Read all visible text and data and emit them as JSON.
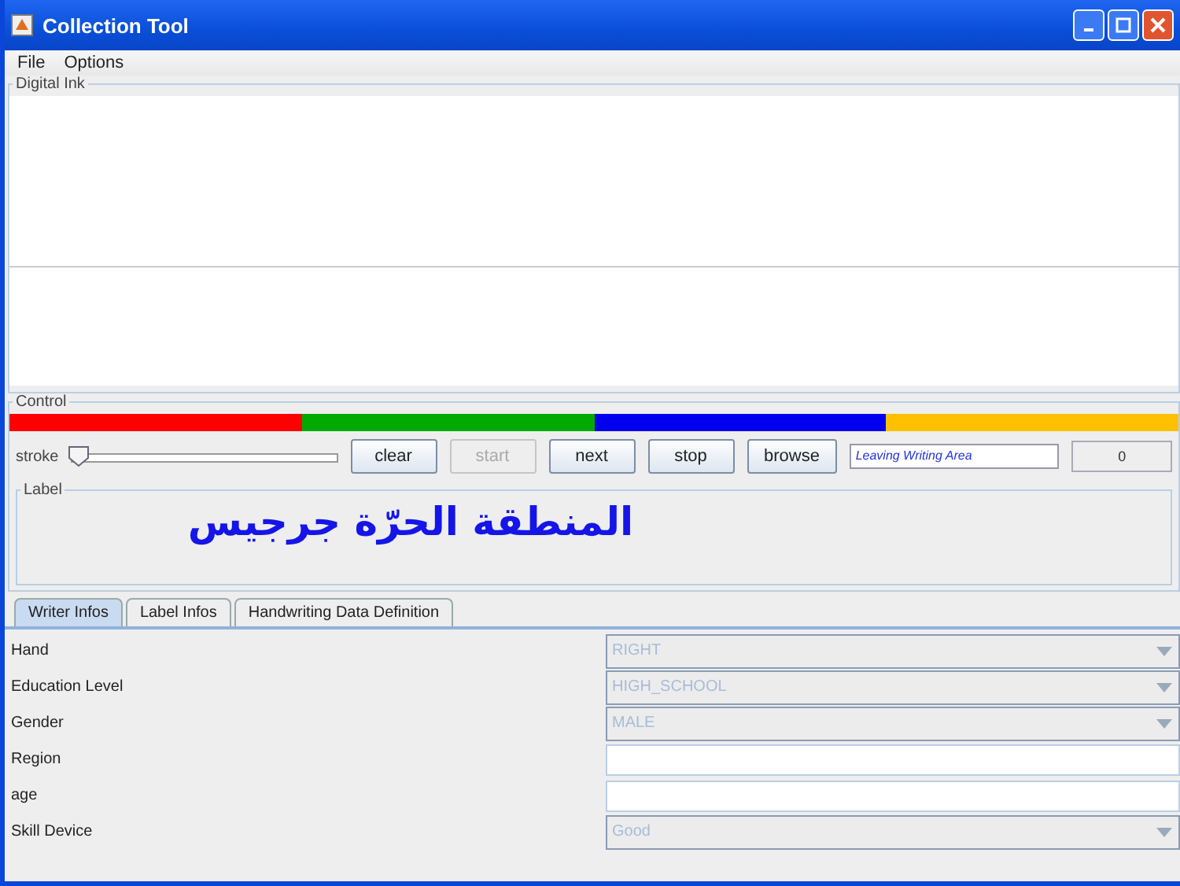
{
  "window": {
    "title": "Collection Tool"
  },
  "menu": [
    "File",
    "Options"
  ],
  "digital_ink": {
    "title": "Digital Ink"
  },
  "control": {
    "title": "Control",
    "color_bar": [
      {
        "color": "#ff0000"
      },
      {
        "color": "#00aa00"
      },
      {
        "color": "#0000ee"
      },
      {
        "color": "#ffc000"
      }
    ],
    "stroke": {
      "label": "stroke",
      "level": 0.0
    },
    "buttons": [
      {
        "label": "clear",
        "disabled": false
      },
      {
        "label": "start",
        "disabled": true
      },
      {
        "label": "next",
        "disabled": false
      },
      {
        "label": "stop",
        "disabled": false
      },
      {
        "label": "browse",
        "disabled": false
      }
    ],
    "status_field": "Leaving Writing Area",
    "count": "0"
  },
  "label": {
    "title": "Label",
    "text": "المنطقة الحرّة جرجيس"
  },
  "tabs": [
    {
      "label": "Writer Infos",
      "selected": true
    },
    {
      "label": "Label Infos",
      "selected": false
    },
    {
      "label": "Handwriting Data Definition",
      "selected": false
    }
  ],
  "fields": [
    {
      "label": "Hand",
      "kind": "combo",
      "value": "RIGHT",
      "disabled": true
    },
    {
      "label": "Education Level",
      "kind": "combo",
      "value": "HIGH_SCHOOL",
      "disabled": true
    },
    {
      "label": "Gender",
      "kind": "combo",
      "value": "MALE",
      "disabled": true
    },
    {
      "label": "Region",
      "kind": "text"
    },
    {
      "label": "age",
      "kind": "text"
    },
    {
      "label": "Skill Device",
      "kind": "combo",
      "value": "Good",
      "disabled": true
    }
  ]
}
